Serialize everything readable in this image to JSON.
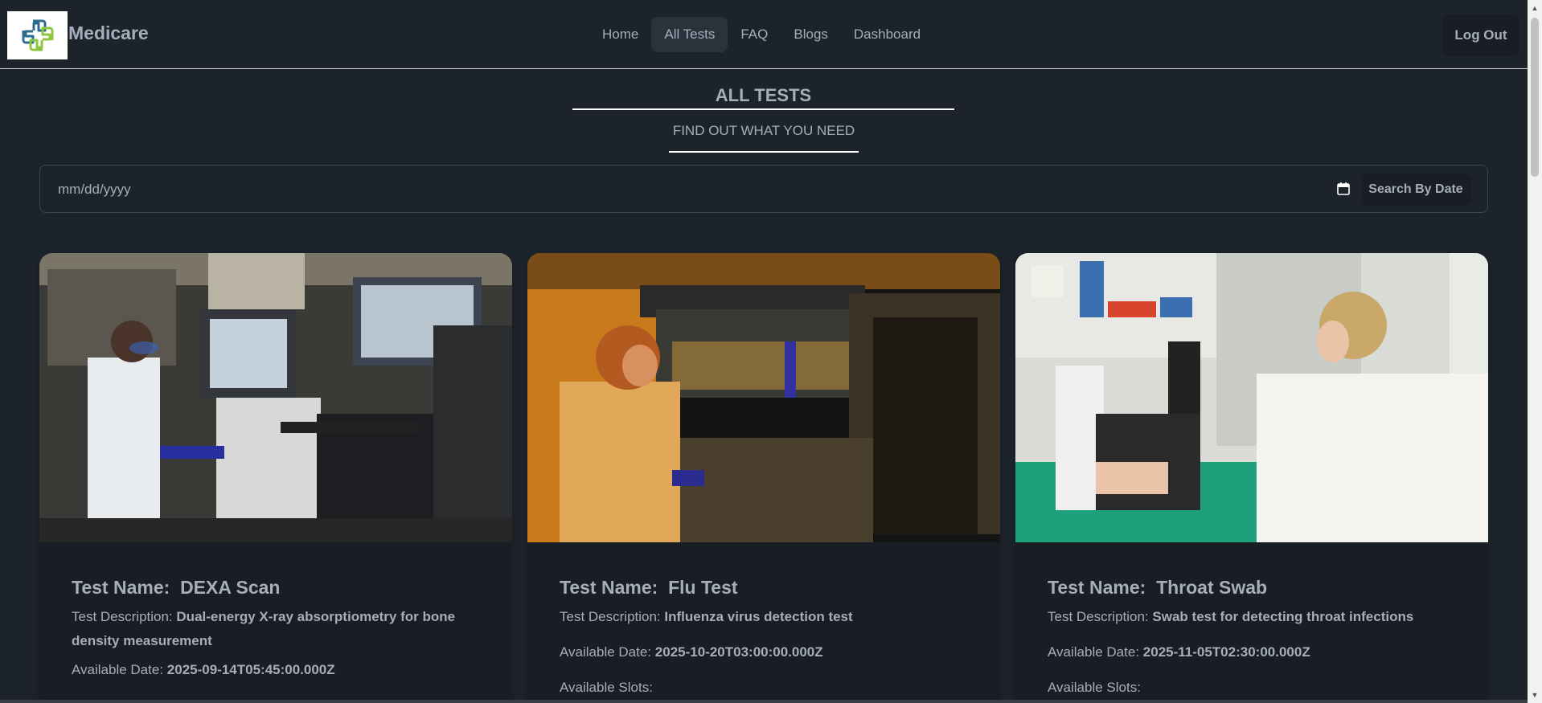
{
  "brand": {
    "name": "Medicare",
    "logo_icon": "medical-cross-logo"
  },
  "nav": {
    "items": [
      {
        "label": "Home",
        "active": false
      },
      {
        "label": "All Tests",
        "active": true
      },
      {
        "label": "FAQ",
        "active": false
      },
      {
        "label": "Blogs",
        "active": false
      },
      {
        "label": "Dashboard",
        "active": false
      }
    ],
    "logout_label": "Log Out"
  },
  "page": {
    "title": "ALL TESTS",
    "subtitle": "FIND OUT WHAT YOU NEED"
  },
  "search": {
    "date_placeholder": "mm/dd/yyyy",
    "button_label": "Search By Date",
    "icon": "calendar-icon"
  },
  "labels": {
    "test_name": "Test Name:",
    "test_description": "Test Description:",
    "available_date": "Available Date:",
    "available_slots": "Available Slots:"
  },
  "tests": [
    {
      "name": "DEXA Scan",
      "description": "Dual-energy X-ray absorptiometry for bone density measurement",
      "available_date": "2025-09-14T05:45:00.000Z",
      "image": "scientist operating lab analyzer"
    },
    {
      "name": "Flu Test",
      "description": "Influenza virus detection test",
      "available_date": "2025-10-20T03:00:00.000Z",
      "image": "scientist with pipette at lab machine"
    },
    {
      "name": "Throat Swab",
      "description": "Swab test for detecting throat infections",
      "available_date": "2025-11-05T02:30:00.000Z",
      "image": "scientist using microscope"
    }
  ],
  "colors": {
    "background": "#1d232a",
    "card": "#191e24",
    "active_nav": "#2a323c",
    "text": "#a6adbb",
    "accent_logo": "#8cc63f"
  }
}
